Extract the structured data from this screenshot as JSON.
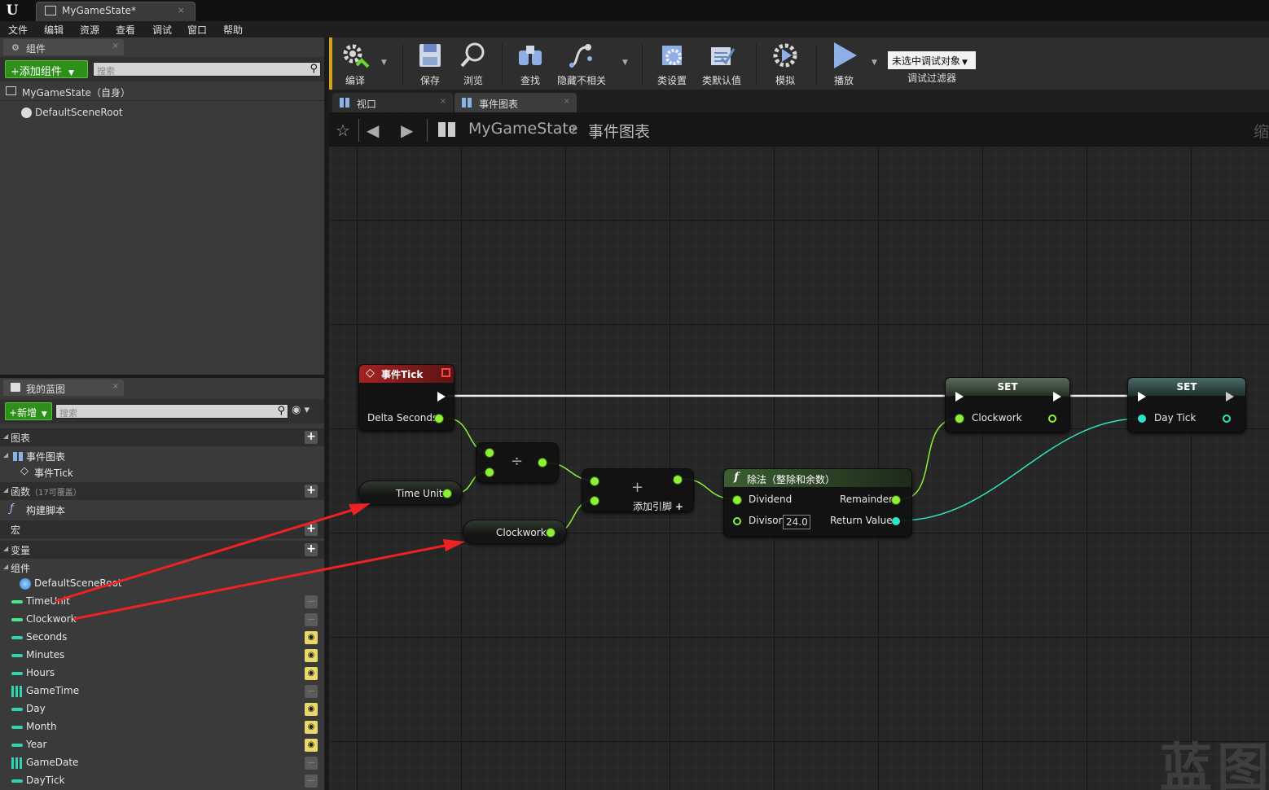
{
  "window": {
    "tab_title": "MyGameState*",
    "close": "×",
    "logo": "U"
  },
  "menu": [
    "文件",
    "编辑",
    "资源",
    "查看",
    "调试",
    "窗口",
    "帮助"
  ],
  "components_panel": {
    "tab": "组件",
    "add_button": "+添加组件",
    "search_placeholder": "搜索",
    "self_item": "MyGameState（自身）",
    "root_item": "DefaultSceneRoot"
  },
  "toolbar": {
    "compile": "编译",
    "save": "保存",
    "browse": "浏览",
    "find": "查找",
    "hide_unrelated": "隐藏不相关",
    "class_settings": "类设置",
    "class_defaults": "类默认值",
    "simulate": "模拟",
    "play": "播放",
    "debug_object": "未选中调试对象",
    "debug_filter": "调试过滤器"
  },
  "tabs": {
    "viewport": "视口",
    "event_graph": "事件图表"
  },
  "breadcrumb": {
    "root": "MyGameState",
    "leaf": "事件图表",
    "zoom": "缩"
  },
  "watermark": "蓝图",
  "my_blueprint": {
    "tab": "我的蓝图",
    "new_button": "新增",
    "search_placeholder": "搜索",
    "sections": {
      "graphs": "图表",
      "event_graph": "事件图表",
      "event_tick": "事件Tick",
      "functions": "函数",
      "functions_note": "（17可覆盖）",
      "construction_script": "构建脚本",
      "macros": "宏",
      "variables": "变量",
      "components": "组件",
      "default_scene_root": "DefaultSceneRoot"
    },
    "variables": [
      {
        "name": "TimeUnit",
        "type": "float",
        "visible": false
      },
      {
        "name": "Clockwork",
        "type": "float",
        "visible": false
      },
      {
        "name": "Seconds",
        "type": "int",
        "visible": true
      },
      {
        "name": "Minutes",
        "type": "int",
        "visible": true
      },
      {
        "name": "Hours",
        "type": "int",
        "visible": true
      },
      {
        "name": "GameTime",
        "type": "array",
        "visible": false
      },
      {
        "name": "Day",
        "type": "int",
        "visible": true
      },
      {
        "name": "Month",
        "type": "int",
        "visible": true
      },
      {
        "name": "Year",
        "type": "int",
        "visible": true
      },
      {
        "name": "GameDate",
        "type": "array",
        "visible": false
      },
      {
        "name": "DayTick",
        "type": "int",
        "visible": false
      }
    ]
  },
  "graph": {
    "event_tick": {
      "title": "事件Tick",
      "pin_delta": "Delta Seconds"
    },
    "time_unit_get": "Time Unit",
    "clockwork_get": "Clockwork",
    "divide_symbol": "÷",
    "add_node": {
      "symbol": "+",
      "add_pin": "添加引脚"
    },
    "divide_fn": {
      "title": "除法（整除和余数）",
      "dividend": "Dividend",
      "divisor": "Divisor",
      "divisor_value": "24.0",
      "remainder": "Remainder",
      "return_value": "Return Value",
      "icon": "f"
    },
    "set_clockwork": {
      "title": "SET",
      "pin": "Clockwork"
    },
    "set_daytick": {
      "title": "SET",
      "pin": "Day Tick"
    }
  },
  "colors": {
    "float_pin": "#8cf237",
    "int_pin": "#2fe3c3",
    "exec": "#ffffff",
    "annotation_arrow": "#ee2222",
    "toolbar_accent": "#d2a21f"
  }
}
